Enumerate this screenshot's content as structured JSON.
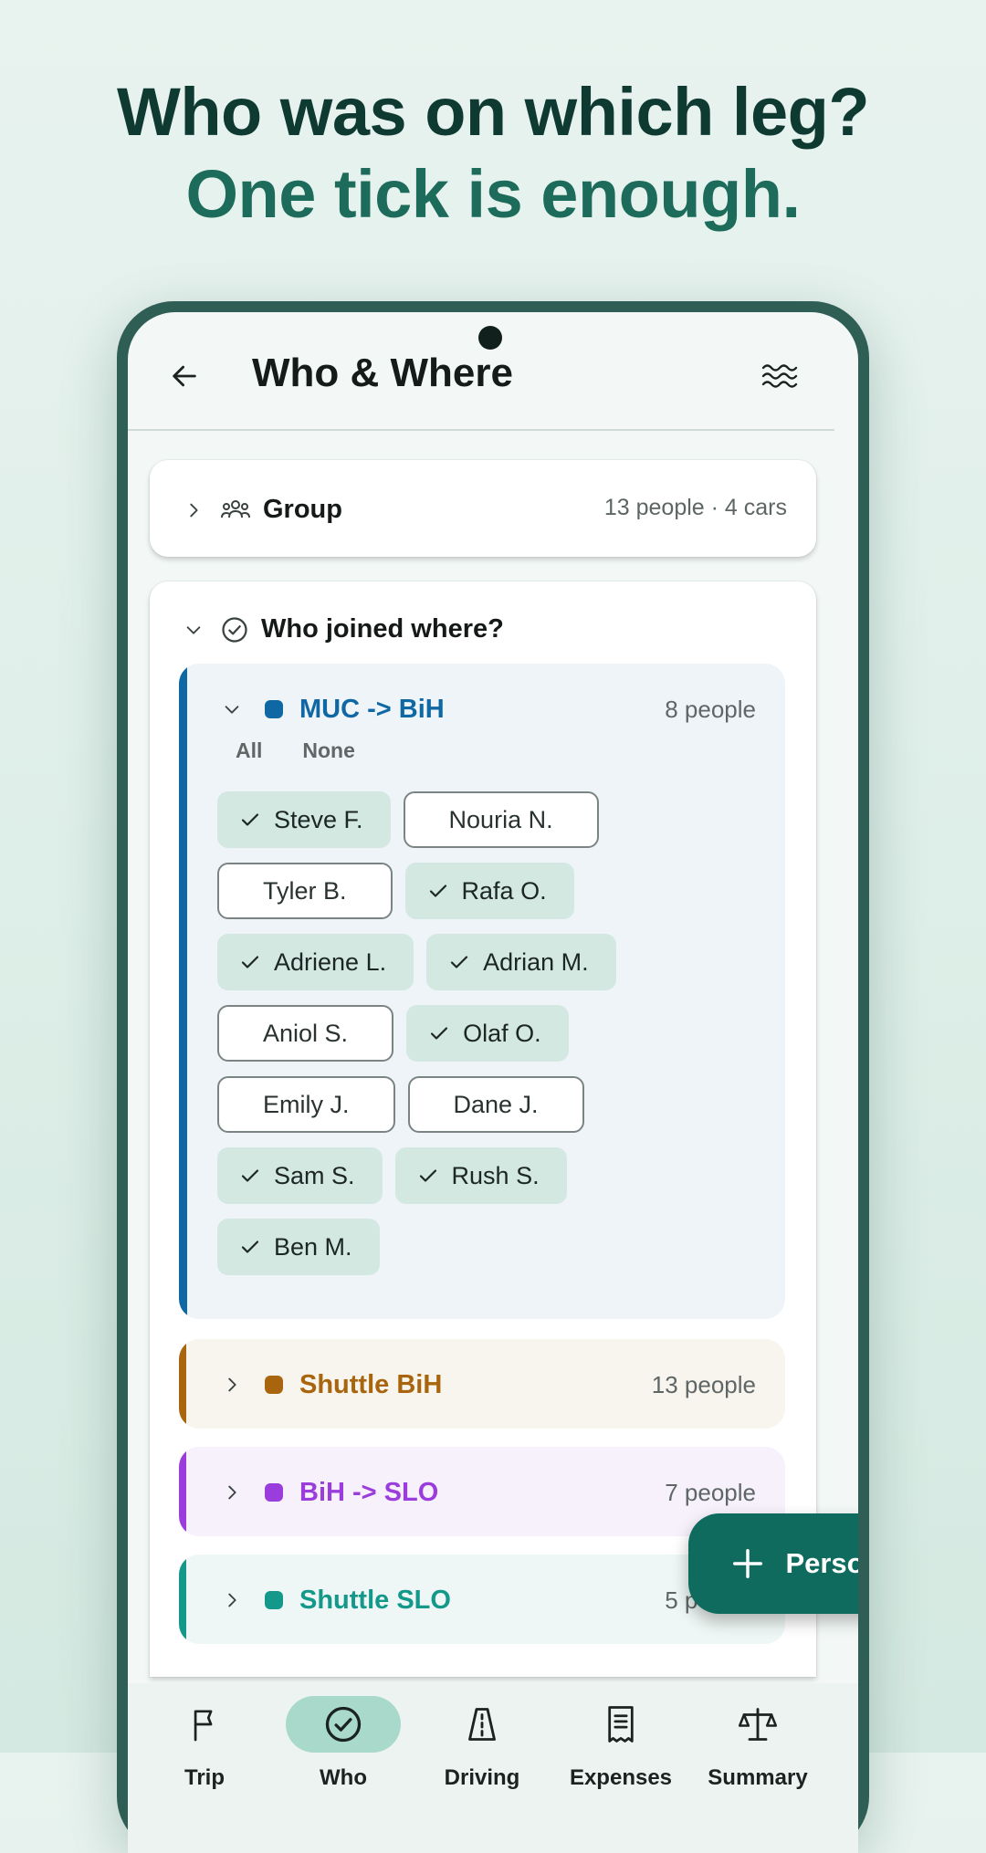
{
  "headline": {
    "line1": "Who was on which leg?",
    "line2": "One tick is enough."
  },
  "appbar": {
    "title": "Who & Where"
  },
  "group": {
    "title": "Group",
    "summary": "13 people · 4 cars"
  },
  "who_joined": {
    "title": "Who joined where?",
    "select_all": "All",
    "select_none": "None",
    "legs": [
      {
        "name": "MUC -> BiH",
        "count": "8 people",
        "color": "#0f68a3",
        "expanded": true,
        "people": [
          {
            "name": "Steve F.",
            "checked": true
          },
          {
            "name": "Nouria N.",
            "checked": false
          },
          {
            "name": "Tyler B.",
            "checked": false
          },
          {
            "name": "Rafa O.",
            "checked": true
          },
          {
            "name": "Adriene L.",
            "checked": true
          },
          {
            "name": "Adrian M.",
            "checked": true
          },
          {
            "name": "Aniol S.",
            "checked": false
          },
          {
            "name": "Olaf O.",
            "checked": true
          },
          {
            "name": "Emily J.",
            "checked": false
          },
          {
            "name": "Dane J.",
            "checked": false
          },
          {
            "name": "Sam S.",
            "checked": true
          },
          {
            "name": "Rush S.",
            "checked": true
          },
          {
            "name": "Ben M.",
            "checked": true
          }
        ]
      },
      {
        "name": "Shuttle BiH",
        "count": "13 people",
        "color": "#a8650d",
        "expanded": false
      },
      {
        "name": "BiH -> SLO",
        "count": "7 people",
        "color": "#9a3ddc",
        "expanded": false
      },
      {
        "name": "Shuttle SLO",
        "count": "5 people",
        "color": "#14988a",
        "expanded": false
      }
    ]
  },
  "fab": {
    "label": "Person",
    "icon": "plus-icon"
  },
  "bottom_nav": [
    {
      "label": "Trip",
      "icon": "flag-icon",
      "active": false
    },
    {
      "label": "Who",
      "icon": "check-circle-icon",
      "active": true
    },
    {
      "label": "Driving",
      "icon": "road-icon",
      "active": false
    },
    {
      "label": "Expenses",
      "icon": "receipt-icon",
      "active": false
    },
    {
      "label": "Summary",
      "icon": "scale-icon",
      "active": false
    }
  ]
}
